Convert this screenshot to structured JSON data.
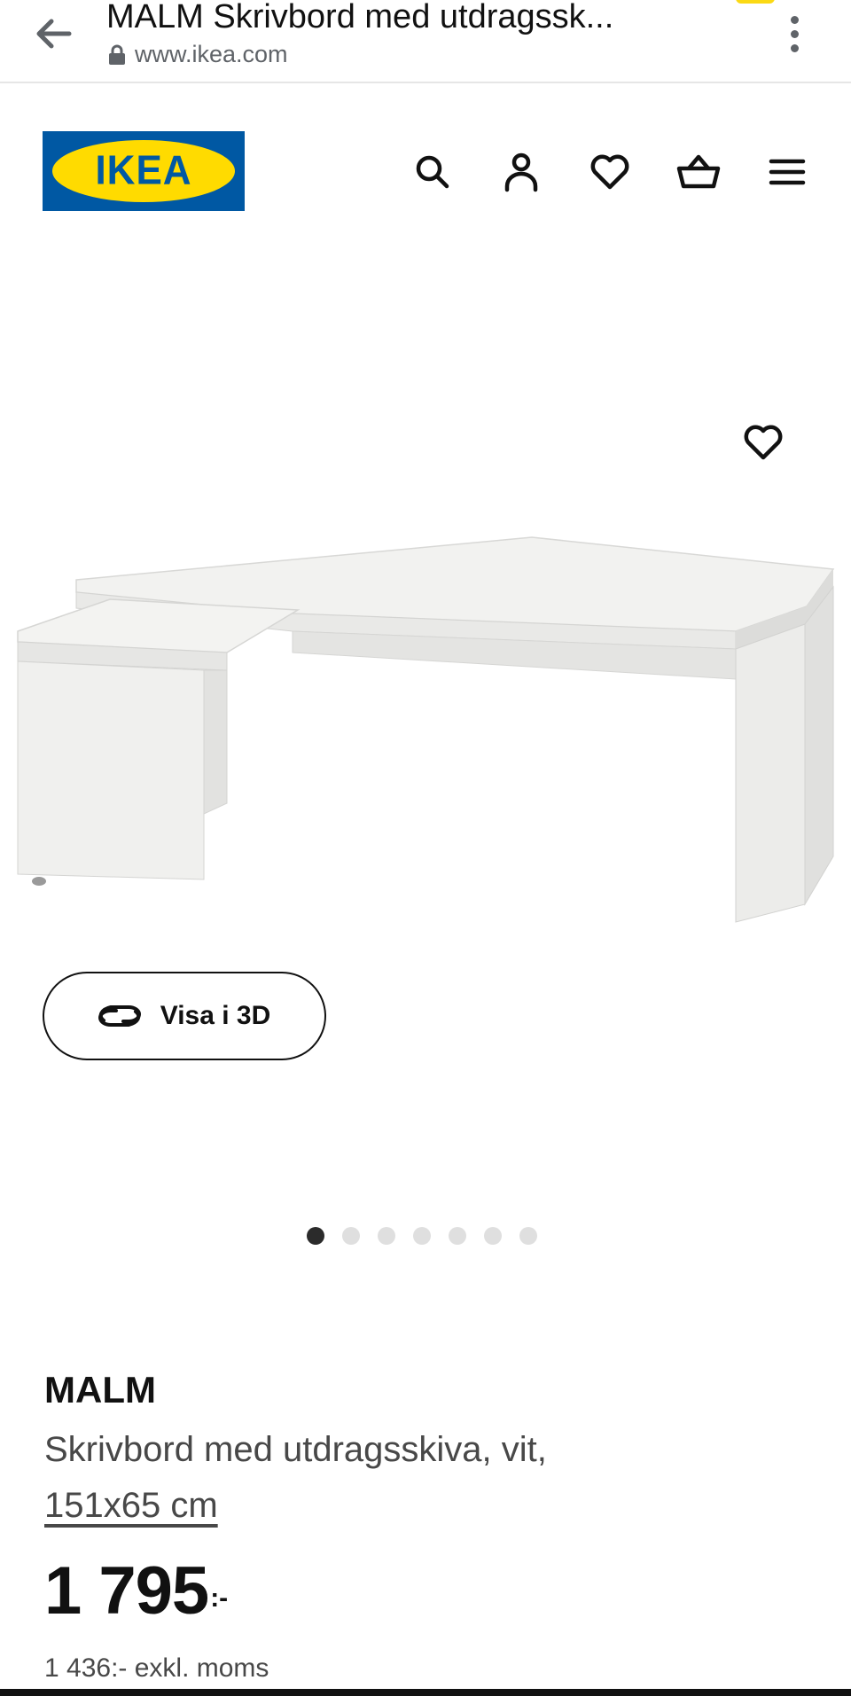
{
  "browser": {
    "title": "MALM Skrivbord med utdragssk...",
    "url": "www.ikea.com",
    "icons": {
      "back": "arrow-left-icon",
      "lock": "lock-icon",
      "menu": "kebab-menu-icon"
    },
    "badge_color": "#fbd914"
  },
  "header": {
    "logo_text": "IKEA",
    "logo_colors": {
      "blue": "#0058a3",
      "yellow": "#ffdb00"
    },
    "icons": [
      "search-icon",
      "profile-icon",
      "heart-icon",
      "cart-icon",
      "hamburger-menu-icon"
    ]
  },
  "gallery": {
    "favorite_icon": "heart-icon",
    "view_3d_label": "Visa i 3D",
    "view_3d_icon": "rotate-3d-icon",
    "image_count": 7,
    "active_image_index": 0
  },
  "product": {
    "name": "MALM",
    "description": "Skrivbord med utdragsskiva, vit,",
    "size": "151x65 cm",
    "price": "1 795",
    "price_suffix": ":-",
    "price_excl_vat": "1 436:- exkl. moms"
  }
}
